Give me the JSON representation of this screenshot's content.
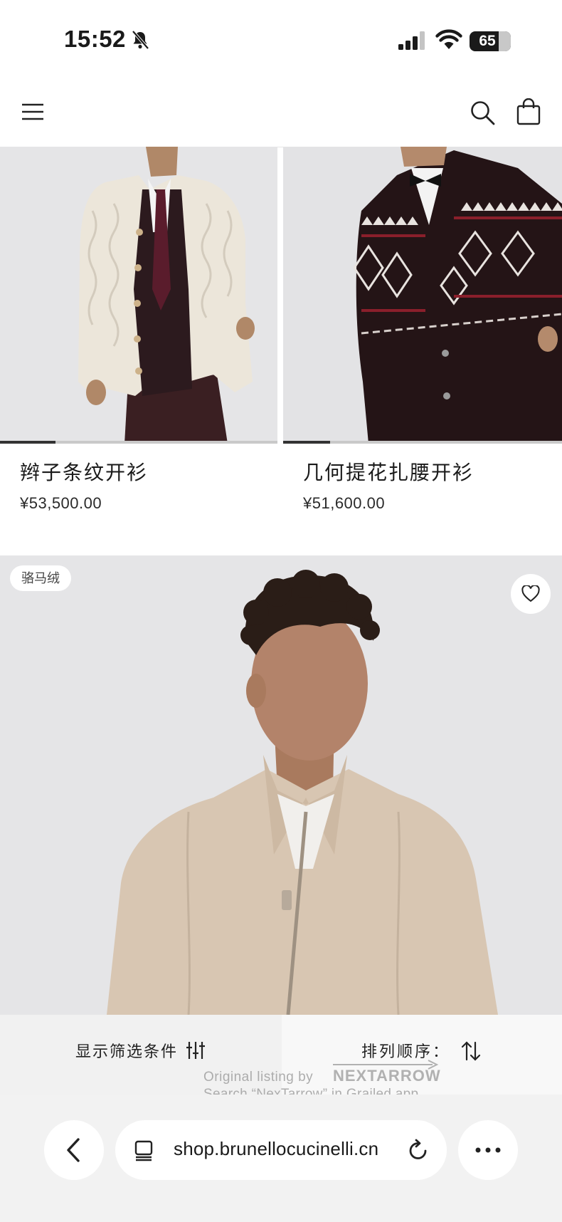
{
  "status_bar": {
    "time": "15:52",
    "battery": "65",
    "icons": [
      "bell-slash-icon",
      "cellular-signal-icon",
      "wifi-icon",
      "battery-icon"
    ]
  },
  "header": {
    "icons": [
      "hamburger-menu-icon",
      "search-icon",
      "shopping-bag-icon"
    ]
  },
  "products": [
    {
      "name": "辫子条纹开衫",
      "price": "¥53,500.00"
    },
    {
      "name": "几何提花扎腰开衫",
      "price": "¥51,600.00"
    }
  ],
  "featured_product": {
    "badge": "骆马绒",
    "icon": "heart-icon"
  },
  "filter_bar": {
    "filter_label": "显示筛选条件",
    "sort_label": "排列顺序：",
    "icons": [
      "sliders-icon",
      "sort-arrows-icon"
    ]
  },
  "watermark": {
    "line1": "Original listing by",
    "brand": "NEXTARROW",
    "line2": "Search “NexTarrow” in Grailed app."
  },
  "browser": {
    "url": "shop.brunellocucinelli.cn",
    "icons": [
      "back-chevron-icon",
      "tabs-icon",
      "reload-icon",
      "more-dots-icon"
    ]
  },
  "colors": {
    "background": "#ffffff",
    "image_background": "#e7e7e9",
    "text": "#1a1a1a",
    "browser_bar": "#f2f2f2"
  }
}
